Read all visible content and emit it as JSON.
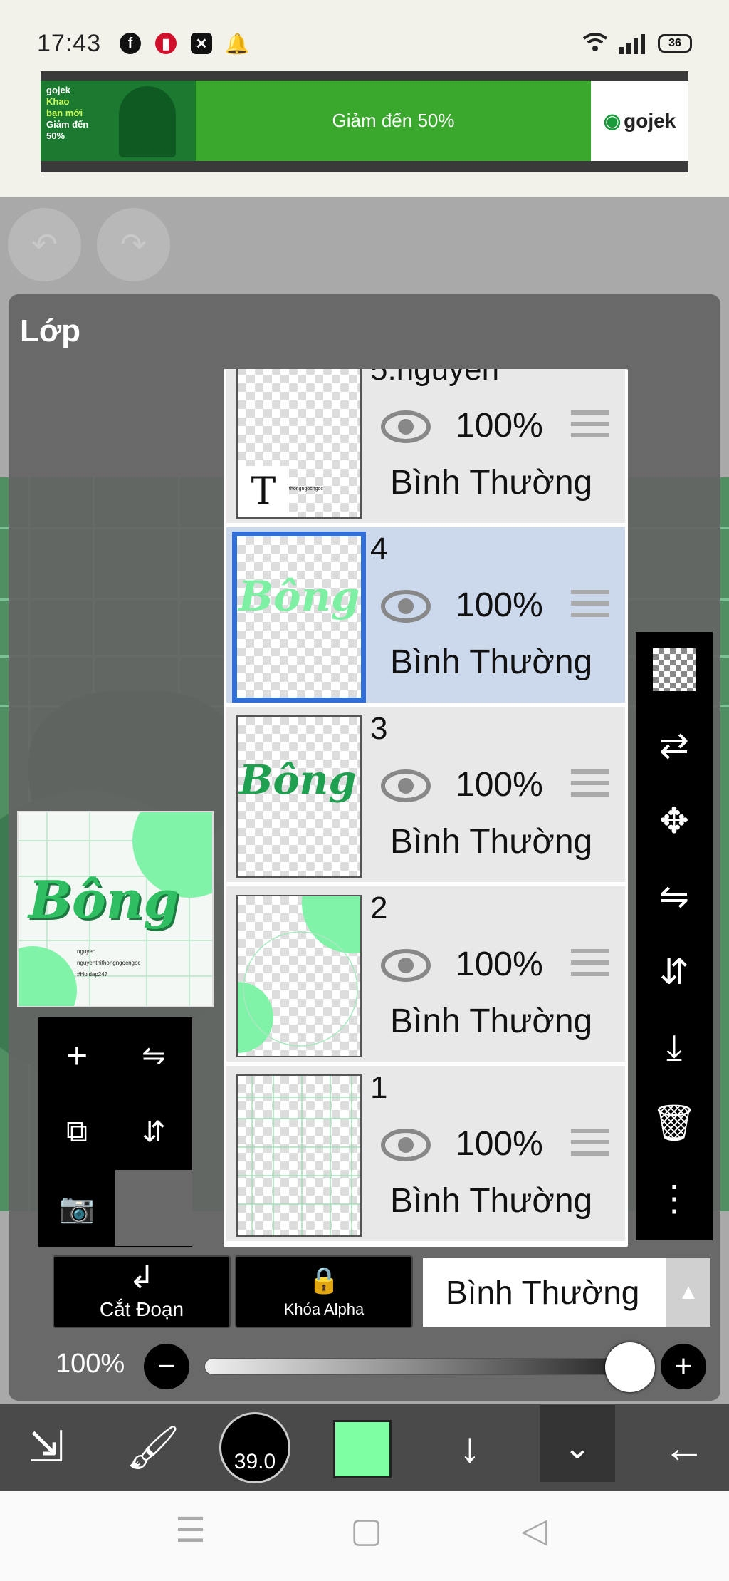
{
  "status_bar": {
    "time": "17:43",
    "battery": "36",
    "icons": [
      "facebook-icon",
      "red-app-icon",
      "capcut-icon",
      "notification-bell-icon",
      "wifi-icon",
      "signal-icon",
      "battery-icon"
    ]
  },
  "ad": {
    "left_text_lines": [
      "gojek",
      "Khao",
      "bạn mới",
      "Giảm đến",
      "50%"
    ],
    "center_text": "Giảm đến 50%",
    "brand": "gojek"
  },
  "panel": {
    "title": "Lớp"
  },
  "preview": {
    "art_text": "Bông",
    "small_lines": [
      "nguyen",
      "nguyenthithongngocngoc",
      "#Hoidap247"
    ]
  },
  "layers": [
    {
      "name": "5:nguyen",
      "opacity": "100%",
      "blend": "Bình Thường",
      "selected": false,
      "thumb_text": "T",
      "thumb_small": "thongngocngoc"
    },
    {
      "name": "4",
      "opacity": "100%",
      "blend": "Bình Thường",
      "selected": true,
      "thumb_art": "Bông"
    },
    {
      "name": "3",
      "opacity": "100%",
      "blend": "Bình Thường",
      "selected": false,
      "thumb_art": "Bông"
    },
    {
      "name": "2",
      "opacity": "100%",
      "blend": "Bình Thường",
      "selected": false
    },
    {
      "name": "1",
      "opacity": "100%",
      "blend": "Bình Thường",
      "selected": false
    }
  ],
  "bottom": {
    "clip_label": "Cắt Đoạn",
    "alpha_lock_label": "Khóa Alpha",
    "blend_mode": "Bình Thường",
    "opacity_label": "100%",
    "opacity_value": 1.0
  },
  "toolbar": {
    "brush_size": "39.0",
    "color": "#7fffa4"
  },
  "colors": {
    "accent_green": "#7fffa4",
    "selection_blue": "#2f6fd6",
    "selected_row": "#ccd8ec"
  }
}
